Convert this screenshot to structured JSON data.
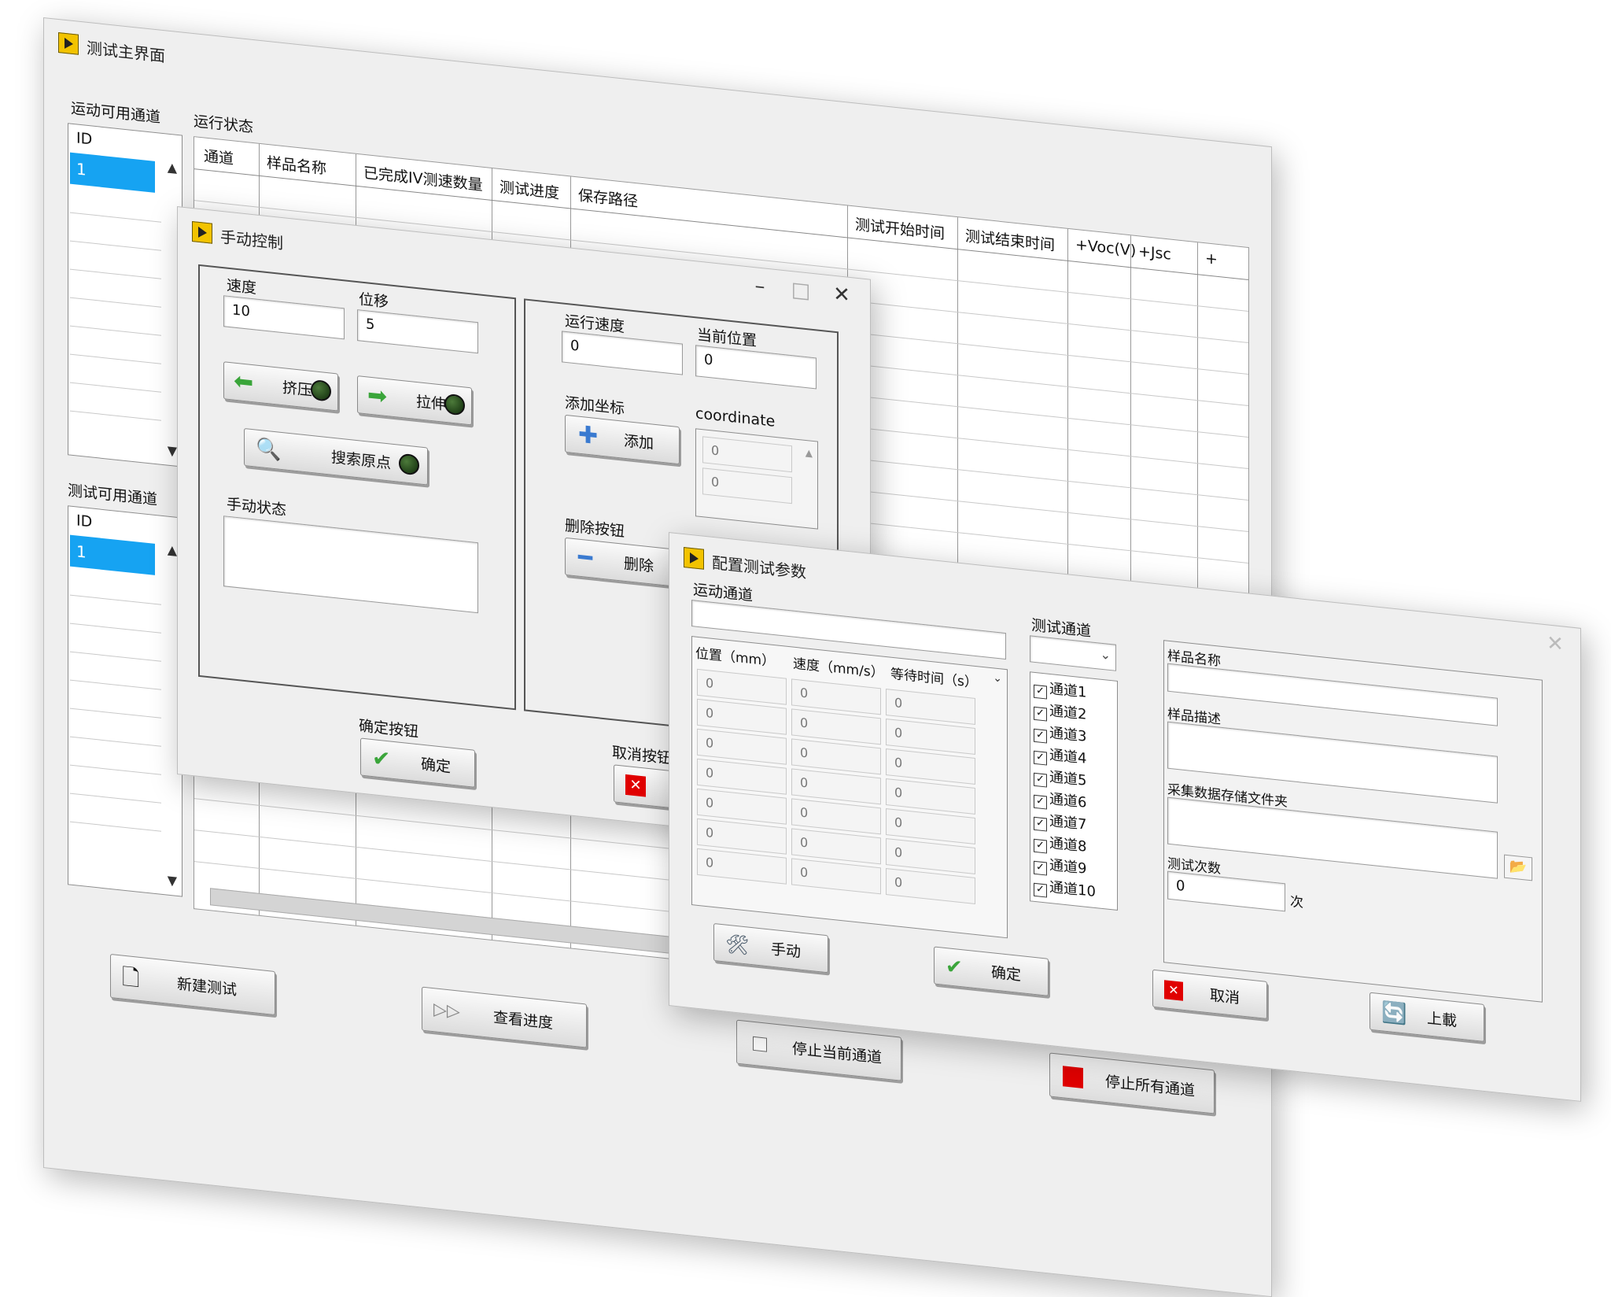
{
  "main_window": {
    "title": "测试主界面",
    "motion_channels_label": "运动可用通道",
    "test_channels_label": "测试可用通道",
    "id_header": "ID",
    "motion_channel_selected": "1",
    "test_channel_selected": "1",
    "run_status_label": "运行状态",
    "table_headers": [
      "通道",
      "样品名称",
      "已完成IV测速数量",
      "测试进度",
      "保存路径",
      "测试开始时间",
      "测试结束时间",
      "+Voc(V)",
      "+Jsc",
      "+"
    ],
    "buttons": {
      "new_test": "新建测试",
      "view_progress": "查看进度",
      "stop_current": "停止当前通道",
      "stop_all": "停止所有通道"
    }
  },
  "manual_window": {
    "title": "手动控制",
    "speed_label": "速度",
    "speed_value": "10",
    "displacement_label": "位移",
    "displacement_value": "5",
    "squeeze_button": "挤压",
    "stretch_button": "拉伸",
    "search_origin_button": "搜索原点",
    "manual_status_label": "手动状态",
    "run_speed_label": "运行速度",
    "run_speed_value": "0",
    "current_position_label": "当前位置",
    "current_position_value": "0",
    "add_coord_label": "添加坐标",
    "add_button": "添加",
    "coordinate_label": "coordinate",
    "coordinate_values": [
      "0",
      "0"
    ],
    "delete_label": "删除按钮",
    "delete_button": "删除",
    "confirm_label": "确定按钮",
    "confirm_button": "确定",
    "cancel_label": "取消按钮"
  },
  "config_window": {
    "title": "配置测试参数",
    "motion_channel_label": "运动通道",
    "col_position": "位置（mm）",
    "col_speed": "速度（mm/s）",
    "col_wait": "等待时间（s）",
    "grid_values": [
      "0",
      "0",
      "0",
      "0",
      "0",
      "0",
      "0"
    ],
    "test_channel_label": "测试通道",
    "channels": [
      "通道1",
      "通道2",
      "通道3",
      "通道4",
      "通道5",
      "通道6",
      "通道7",
      "通道8",
      "通道9",
      "通道10"
    ],
    "sample_name_label": "样品名称",
    "sample_desc_label": "样品描述",
    "data_folder_label": "采集数据存储文件夹",
    "test_count_label": "测试次数",
    "test_count_value": "0",
    "count_unit": "次",
    "buttons": {
      "manual": "手动",
      "confirm": "确定",
      "cancel": "取消",
      "upload": "上載"
    }
  },
  "colors": {
    "selection_blue": "#16a3f2",
    "window_bg": "#efefef",
    "stop_red": "#e00000"
  }
}
